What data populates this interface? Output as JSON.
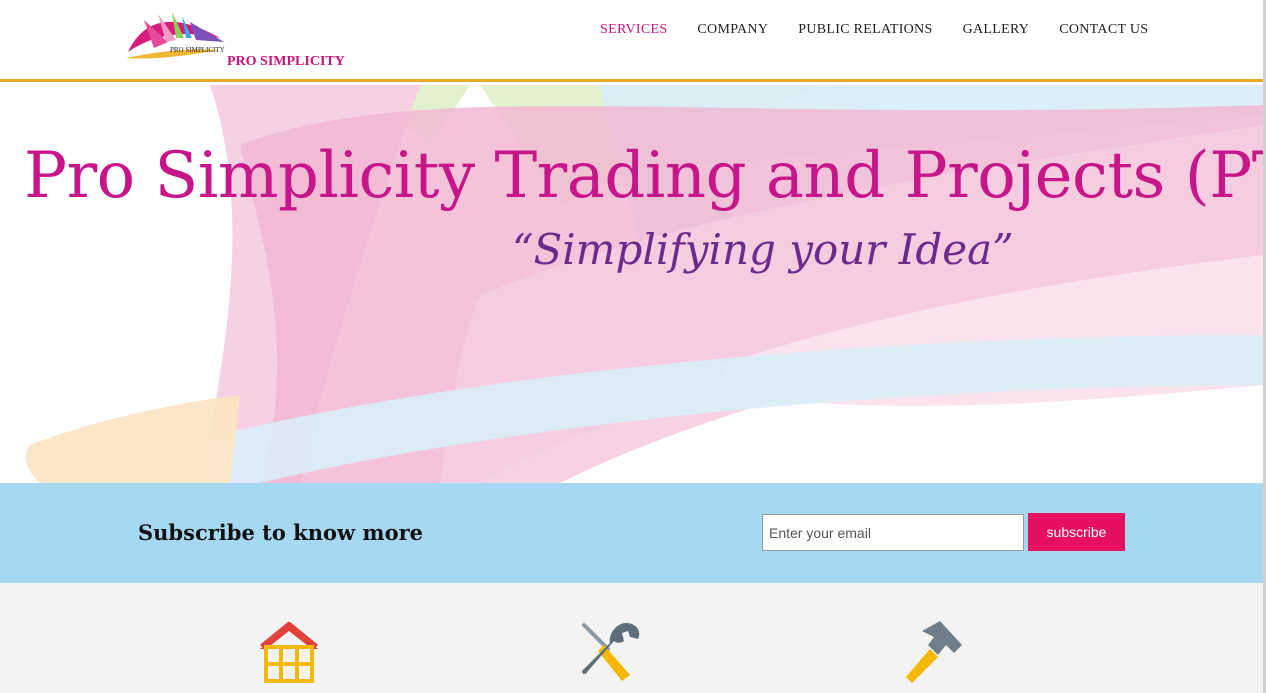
{
  "header": {
    "logo_text": "PRO SIMPLICITY",
    "logo_mark_text": "PRO SIMPLICITY",
    "nav": [
      {
        "label": "SERVICES",
        "active": true
      },
      {
        "label": "COMPANY",
        "active": false
      },
      {
        "label": "PUBLIC RELATIONS",
        "active": false
      },
      {
        "label": "GALLERY",
        "active": false
      },
      {
        "label": "CONTACT US",
        "active": false
      }
    ]
  },
  "hero": {
    "title": "Pro Simplicity Trading and Projects (PT",
    "tagline": "“Simplifying your Idea”"
  },
  "subscribe": {
    "title": "Subscribe to know more",
    "email_placeholder": "Enter your email",
    "button_label": "subscribe"
  },
  "services": {
    "icons": [
      "house-icon",
      "tools-icon",
      "hammer-icon"
    ]
  },
  "colors": {
    "brand_magenta": "#c6168a",
    "tagline_purple": "#6b2a8c",
    "header_border": "#e8a927",
    "subscribe_bg": "#a6d8f2",
    "button_bg": "#e5105f",
    "services_bg": "#f3f3f3"
  }
}
